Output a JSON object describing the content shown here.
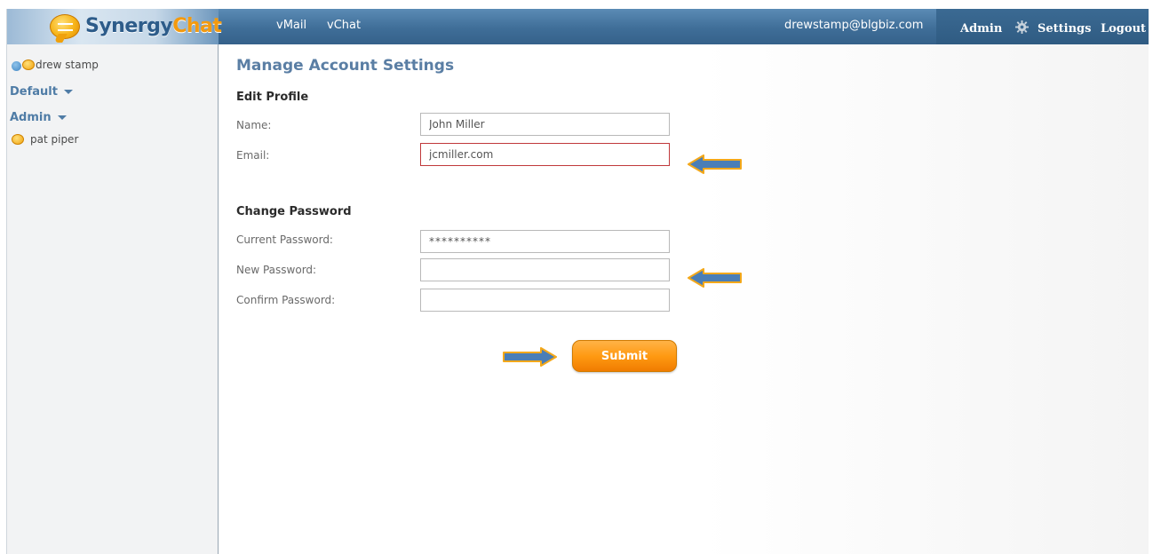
{
  "colors": {
    "header_blue": "#3f6e98",
    "brand_blue": "#2d5c8a",
    "brand_orange": "#f39a0f",
    "title_blue": "#5a7ea4",
    "submit_orange": "#ff9a12",
    "error_red": "#c0393b",
    "arrow_blue": "#4a7eb7",
    "arrow_border": "#f3a81a"
  },
  "header": {
    "logo": {
      "part1": "Synergy",
      "part2": "Chat"
    },
    "nav": [
      {
        "label": "vMail"
      },
      {
        "label": "vChat"
      }
    ],
    "user_email": "drewstamp@blgbiz.com",
    "admin_label": "Admin",
    "settings_label": "Settings",
    "logout_label": "Logout",
    "icons": {
      "settings": "gear-icon",
      "logo": "chat-bubble-icon"
    }
  },
  "sidebar": {
    "user": {
      "name": "drew stamp",
      "status_icon": "check-circle-icon",
      "chat_icon": "chat-bubble-icon"
    },
    "groups": [
      {
        "label": "Default"
      },
      {
        "label": "Admin"
      }
    ],
    "contacts": [
      {
        "name": "pat piper",
        "icon": "chat-bubble-icon"
      }
    ]
  },
  "main": {
    "title": "Manage Account Settings",
    "edit_profile": {
      "heading": "Edit Profile",
      "name_label": "Name:",
      "name_value": "John Miller",
      "email_label": "Email:",
      "email_value": "jcmiller.com"
    },
    "change_password": {
      "heading": "Change Password",
      "current_label": "Current Password:",
      "current_value": "**********",
      "new_label": "New Password:",
      "new_value": "",
      "confirm_label": "Confirm Password:",
      "confirm_value": ""
    },
    "submit_label": "Submit"
  }
}
